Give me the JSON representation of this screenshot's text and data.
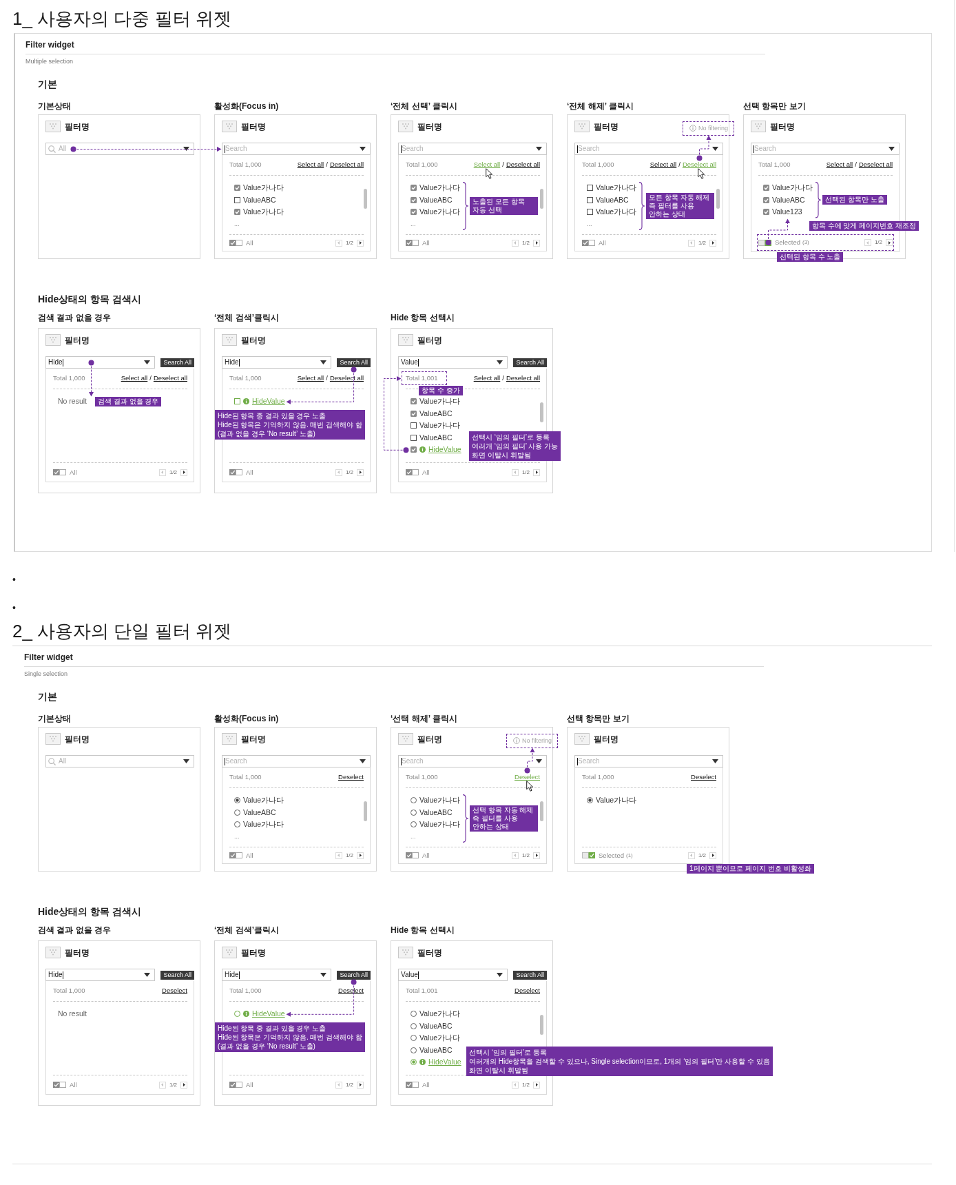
{
  "sections": [
    {
      "title": "1_ 사용자의 다중 필터 위젯",
      "framed": true,
      "widget_title": "Filter widget",
      "widget_subtitle": "Multiple selection",
      "groups": [
        {
          "title": "기본",
          "panels": [
            {
              "heading": "기본상태",
              "filter_name": "필터명",
              "search": {
                "placeholder": "All",
                "icon": true
              },
              "notes": [
                {
                  "kind": "flow-arrow"
                }
              ]
            },
            {
              "heading": "활성화(Focus in)",
              "filter_name": "필터명",
              "search": {
                "placeholder": "Search",
                "focused": true
              },
              "dropdown": {
                "total": "Total 1,000",
                "actions": [
                  {
                    "label": "Select all",
                    "active": false
                  },
                  {
                    "label": "Deselect all",
                    "active": false
                  }
                ],
                "separator": "/",
                "items": [
                  {
                    "kind": "checkbox",
                    "label": "Value가나다",
                    "checked": true,
                    "hidden": false
                  },
                  {
                    "kind": "checkbox",
                    "label": "ValueABC",
                    "checked": false,
                    "hidden": false
                  },
                  {
                    "kind": "checkbox",
                    "label": "Value가나다",
                    "checked": true,
                    "hidden": false
                  }
                ],
                "more": "...",
                "scrollable": true,
                "footer": {
                  "selected_only": false,
                  "label": "All",
                  "pager": "1/2"
                }
              }
            },
            {
              "heading": "‘전체 선택’ 클릭시",
              "filter_name": "필터명",
              "search": {
                "placeholder": "Search",
                "focused": true
              },
              "dropdown": {
                "total": "Total 1,000",
                "actions": [
                  {
                    "label": "Select all",
                    "active": true
                  },
                  {
                    "label": "Deselect all",
                    "active": false
                  }
                ],
                "separator": "/",
                "items": [
                  {
                    "kind": "checkbox",
                    "label": "Value가나다",
                    "checked": true,
                    "hidden": false
                  },
                  {
                    "kind": "checkbox",
                    "label": "ValueABC",
                    "checked": true,
                    "hidden": false
                  },
                  {
                    "kind": "checkbox",
                    "label": "Value가나다",
                    "checked": true,
                    "hidden": false
                  }
                ],
                "more": "...",
                "scrollable": true,
                "footer": {
                  "selected_only": false,
                  "label": "All",
                  "pager": "1/2"
                }
              },
              "notes": [
                {
                  "kind": "brace-note",
                  "lines": [
                    "노출된 모든 항목 자동 선택"
                  ]
                }
              ]
            },
            {
              "heading": "‘전체 해제’ 클릭시",
              "filter_name": "필터명",
              "badge": {
                "text": "No filtering",
                "highlighted": true
              },
              "search": {
                "placeholder": "Search",
                "focused": true
              },
              "dropdown": {
                "total": "Total 1,000",
                "actions": [
                  {
                    "label": "Select all",
                    "active": false
                  },
                  {
                    "label": "Deselect all",
                    "active": true
                  }
                ],
                "separator": "/",
                "items": [
                  {
                    "kind": "checkbox",
                    "label": "Value가나다",
                    "checked": false,
                    "hidden": false
                  },
                  {
                    "kind": "checkbox",
                    "label": "ValueABC",
                    "checked": false,
                    "hidden": false
                  },
                  {
                    "kind": "checkbox",
                    "label": "Value가나다",
                    "checked": false,
                    "hidden": false
                  }
                ],
                "more": "...",
                "scrollable": true,
                "footer": {
                  "selected_only": false,
                  "label": "All",
                  "pager": "1/2"
                }
              },
              "notes": [
                {
                  "kind": "badge-arrow"
                },
                {
                  "kind": "brace-note",
                  "lines": [
                    "모든 항목 자동 해제",
                    "즉 필터를 사용 안하는 상태"
                  ]
                }
              ]
            },
            {
              "heading": "선택 항목만 보기",
              "filter_name": "필터명",
              "search": {
                "placeholder": "Search",
                "focused": true
              },
              "dropdown": {
                "total": "Total 1,000",
                "actions": [
                  {
                    "label": "Select all",
                    "active": false
                  },
                  {
                    "label": "Deselect all",
                    "active": false
                  }
                ],
                "separator": "/",
                "items": [
                  {
                    "kind": "checkbox",
                    "label": "Value가나다",
                    "checked": true,
                    "hidden": false
                  },
                  {
                    "kind": "checkbox",
                    "label": "ValueABC",
                    "checked": true,
                    "hidden": false
                  },
                  {
                    "kind": "checkbox",
                    "label": "Value123",
                    "checked": true,
                    "hidden": false
                  }
                ],
                "footer": {
                  "highlighted": true,
                  "selected_only": true,
                  "label": "Selected",
                  "count": "(3)",
                  "pager": "1/2"
                }
              },
              "notes": [
                {
                  "kind": "brace-note",
                  "lines": [
                    "선택된 항목만 노출"
                  ]
                },
                {
                  "kind": "footer-arrow"
                },
                {
                  "kind": "pager-note",
                  "lines": [
                    "항목 수에 맞게 페이지번호 재조정"
                  ]
                },
                {
                  "kind": "count-note",
                  "lines": [
                    "선택된 항목 수 노출"
                  ]
                }
              ]
            }
          ]
        },
        {
          "title": "Hide상태의 항목 검색시",
          "panels": [
            {
              "heading": "검색 결과 없을 경우",
              "filter_name": "필터명",
              "search": {
                "value": "Hide",
                "focused": true
              },
              "search_all": "Search All",
              "dropdown": {
                "total": "Total 1,000",
                "actions": [
                  {
                    "label": "Select all",
                    "active": false
                  },
                  {
                    "label": "Deselect all",
                    "active": false
                  }
                ],
                "separator": "/",
                "no_result": "No result",
                "footer": {
                  "selected_only": false,
                  "label": "All",
                  "pager": "1/2"
                }
              },
              "notes": [
                {
                  "kind": "result-arrow"
                },
                {
                  "kind": "result-note",
                  "lines": [
                    "검색 결과 없을 경우"
                  ]
                }
              ]
            },
            {
              "heading": "‘전체 검색’클릭시",
              "filter_name": "필터명",
              "search": {
                "value": "Hide",
                "focused": true
              },
              "search_all": "Search All",
              "dropdown": {
                "total": "Total 1,000",
                "actions": [
                  {
                    "label": "Select all",
                    "active": false
                  },
                  {
                    "label": "Deselect all",
                    "active": false
                  }
                ],
                "separator": "/",
                "items": [
                  {
                    "kind": "checkbox",
                    "label": "HideValue",
                    "checked": false,
                    "hidden": true
                  }
                ],
                "footer": {
                  "selected_only": false,
                  "label": "All",
                  "pager": "1/2"
                }
              },
              "notes": [
                {
                  "kind": "button-arrow"
                },
                {
                  "kind": "callout",
                  "lines": [
                    "Hide된 항목 중 결과 있을 경우 노출",
                    "Hide된 항목은 기억하지 않음. 매번 검색해야 함",
                    "(결과 없을 경우 ‘No result’ 노출)"
                  ]
                }
              ]
            },
            {
              "heading": "Hide 항목 선택시",
              "filter_name": "필터명",
              "search": {
                "value": "Value",
                "focused": true
              },
              "search_all": "Search All",
              "dropdown": {
                "total": "Total 1,001",
                "total_highlighted": true,
                "actions": [
                  {
                    "label": "Select all",
                    "active": false
                  },
                  {
                    "label": "Deselect all",
                    "active": false
                  }
                ],
                "separator": "/",
                "items": [
                  {
                    "kind": "checkbox",
                    "label": "Value가나다",
                    "checked": true,
                    "hidden": false
                  },
                  {
                    "kind": "checkbox",
                    "label": "ValueABC",
                    "checked": true,
                    "hidden": false
                  },
                  {
                    "kind": "checkbox",
                    "label": "Value가나다",
                    "checked": false,
                    "hidden": false
                  },
                  {
                    "kind": "checkbox",
                    "label": "ValueABC",
                    "checked": false,
                    "hidden": false
                  },
                  {
                    "kind": "checkbox",
                    "label": "HideValue",
                    "checked": true,
                    "hidden": true
                  }
                ],
                "scrollable": true,
                "footer": {
                  "selected_only": false,
                  "label": "All",
                  "pager": "1/2"
                }
              },
              "notes": [
                {
                  "kind": "total-note",
                  "lines": [
                    "항목 수 증가"
                  ]
                },
                {
                  "kind": "total-arrow"
                },
                {
                  "kind": "side-callout",
                  "lines": [
                    "선택시 ‘임의 필터’로 등록",
                    "여러개 ‘임의 필터’ 사용 가능",
                    "화면 이탈시 휘발됨"
                  ]
                }
              ]
            }
          ]
        }
      ]
    },
    {
      "title": "2_ 사용자의 단일 필터 위젯",
      "widget_title": "Filter widget",
      "widget_subtitle": "Single selection",
      "groups": [
        {
          "title": "기본",
          "panels": [
            {
              "heading": "기본상태",
              "filter_name": "필터명",
              "search": {
                "placeholder": "All",
                "icon": true
              }
            },
            {
              "heading": "활성화(Focus in)",
              "filter_name": "필터명",
              "search": {
                "placeholder": "Search",
                "focused": true
              },
              "dropdown": {
                "total": "Total 1,000",
                "actions": [
                  {
                    "label": "Deselect",
                    "active": false
                  }
                ],
                "items": [
                  {
                    "kind": "radio",
                    "label": "Value가나다",
                    "checked": true,
                    "hidden": false
                  },
                  {
                    "kind": "radio",
                    "label": "ValueABC",
                    "checked": false,
                    "hidden": false
                  },
                  {
                    "kind": "radio",
                    "label": "Value가나다",
                    "checked": false,
                    "hidden": false
                  }
                ],
                "more": "...",
                "scrollable": true,
                "footer": {
                  "selected_only": false,
                  "label": "All",
                  "pager": "1/2"
                }
              }
            },
            {
              "heading": "‘선택 해제’ 클릭시",
              "filter_name": "필터명",
              "badge": {
                "text": "No filtering",
                "highlighted": true
              },
              "search": {
                "placeholder": "Search",
                "focused": true
              },
              "dropdown": {
                "total": "Total 1,000",
                "actions": [
                  {
                    "label": "Deselect",
                    "active": true
                  }
                ],
                "items": [
                  {
                    "kind": "radio",
                    "label": "Value가나다",
                    "checked": false,
                    "hidden": false
                  },
                  {
                    "kind": "radio",
                    "label": "ValueABC",
                    "checked": false,
                    "hidden": false
                  },
                  {
                    "kind": "radio",
                    "label": "Value가나다",
                    "checked": false,
                    "hidden": false
                  }
                ],
                "more": "...",
                "scrollable": true,
                "footer": {
                  "selected_only": false,
                  "label": "All",
                  "pager": "1/2"
                }
              },
              "notes": [
                {
                  "kind": "badge-arrow"
                },
                {
                  "kind": "brace-note",
                  "lines": [
                    "선택 항목 자동 해제",
                    "즉 필터를 사용 안하는 상태"
                  ]
                }
              ]
            },
            {
              "heading": "선택 항목만 보기",
              "filter_name": "필터명",
              "search": {
                "placeholder": "Search",
                "focused": true
              },
              "dropdown": {
                "total": "Total 1,000",
                "actions": [
                  {
                    "label": "Deselect",
                    "active": false
                  }
                ],
                "items": [
                  {
                    "kind": "radio",
                    "label": "Value가나다",
                    "checked": true,
                    "hidden": false
                  }
                ],
                "footer": {
                  "selected_only": true,
                  "label": "Selected",
                  "count": "(1)",
                  "pager": "1/2"
                }
              },
              "notes": [
                {
                  "kind": "pager-note-below",
                  "lines": [
                    "1페이지 뿐이므로 페이지 번호 비활성화"
                  ]
                }
              ]
            }
          ]
        },
        {
          "title": "Hide상태의 항목 검색시",
          "panels": [
            {
              "heading": "검색 결과 없을 경우",
              "filter_name": "필터명",
              "search": {
                "value": "Hide",
                "focused": true
              },
              "search_all": "Search All",
              "dropdown": {
                "total": "Total 1,000",
                "actions": [
                  {
                    "label": "Deselect",
                    "active": false
                  }
                ],
                "no_result": "No result",
                "footer": {
                  "selected_only": false,
                  "label": "All",
                  "pager": "1/2"
                }
              }
            },
            {
              "heading": "‘전체 검색’클릭시",
              "filter_name": "필터명",
              "search": {
                "value": "Hide",
                "focused": true
              },
              "search_all": "Search All",
              "dropdown": {
                "total": "Total 1,000",
                "actions": [
                  {
                    "label": "Deselect",
                    "active": false
                  }
                ],
                "items": [
                  {
                    "kind": "radio",
                    "label": "HideValue",
                    "checked": false,
                    "hidden": true
                  }
                ],
                "footer": {
                  "selected_only": false,
                  "label": "All",
                  "pager": "1/2"
                }
              },
              "notes": [
                {
                  "kind": "button-arrow"
                },
                {
                  "kind": "callout",
                  "lines": [
                    "Hide된 항목 중 결과 있을 경우 노출",
                    "Hide된 항목은 기억하지 않음. 매번 검색해야 함",
                    "(결과 없을 경우 ‘No result’ 노출)"
                  ]
                }
              ]
            },
            {
              "heading": "Hide 항목 선택시",
              "filter_name": "필터명",
              "search": {
                "value": "Value",
                "focused": true
              },
              "search_all": "Search All",
              "dropdown": {
                "total": "Total 1,001",
                "actions": [
                  {
                    "label": "Deselect",
                    "active": false
                  }
                ],
                "items": [
                  {
                    "kind": "radio",
                    "label": "Value가나다",
                    "checked": false,
                    "hidden": false
                  },
                  {
                    "kind": "radio",
                    "label": "ValueABC",
                    "checked": false,
                    "hidden": false
                  },
                  {
                    "kind": "radio",
                    "label": "Value가나다",
                    "checked": false,
                    "hidden": false
                  },
                  {
                    "kind": "radio",
                    "label": "ValueABC",
                    "checked": false,
                    "hidden": false
                  },
                  {
                    "kind": "radio",
                    "label": "HideValue",
                    "checked": true,
                    "hidden": true
                  }
                ],
                "scrollable": true,
                "footer": {
                  "selected_only": false,
                  "label": "All",
                  "pager": "1/2"
                }
              },
              "notes": [
                {
                  "kind": "wide-callout",
                  "lines": [
                    "선택시 ‘임의 필터’로 등록",
                    "여러개의 Hide항목을 검색할 수 있으나, Single selection이므로, 1개의 ‘임의 필터’만 사용할 수 있음",
                    "화면 이탈시 휘발됨"
                  ]
                }
              ]
            }
          ]
        }
      ]
    }
  ],
  "separator_bullets": [
    "•",
    "•"
  ]
}
